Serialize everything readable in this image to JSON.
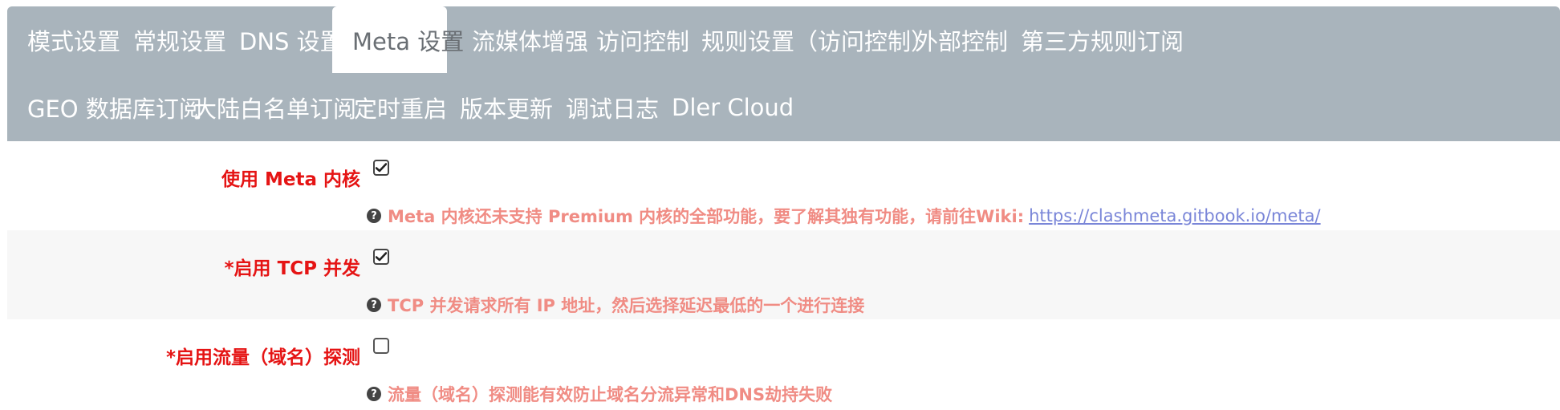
{
  "tabs_row1": [
    {
      "label": "模式设置"
    },
    {
      "label": "常规设置"
    },
    {
      "label": "DNS 设置"
    },
    {
      "label": "Meta 设置",
      "active": true
    },
    {
      "label": "流媒体增强"
    },
    {
      "label": "访问控制"
    },
    {
      "label": "规则设置（访问控制）"
    },
    {
      "label": "外部控制"
    },
    {
      "label": "第三方规则订阅"
    }
  ],
  "tabs_row2": [
    {
      "label": "GEO 数据库订阅"
    },
    {
      "label": "大陆白名单订阅"
    },
    {
      "label": "定时重启"
    },
    {
      "label": "版本更新"
    },
    {
      "label": "调试日志"
    },
    {
      "label": "Dler Cloud"
    }
  ],
  "settings": [
    {
      "label": "使用 Meta 内核",
      "checked": true,
      "help": "Meta 内核还未支持 Premium 内核的全部功能，要了解其独有功能，请前往Wiki:",
      "link": "https://clashmeta.gitbook.io/meta/"
    },
    {
      "label": "*启用 TCP 并发",
      "checked": true,
      "help": "TCP 并发请求所有 IP 地址，然后选择延迟最低的一个进行连接"
    },
    {
      "label": "*启用流量（域名）探测",
      "checked": false,
      "help": "流量（域名）探测能有效防止域名分流异常和DNS劫持失败"
    }
  ],
  "colors": {
    "tab_bar": "#a9b4bc",
    "label_red": "#e51414",
    "help_salmon": "#f08c84",
    "link": "#7a86d8"
  },
  "icons": {
    "help": "question-circle-icon",
    "check": "checkmark-icon"
  }
}
